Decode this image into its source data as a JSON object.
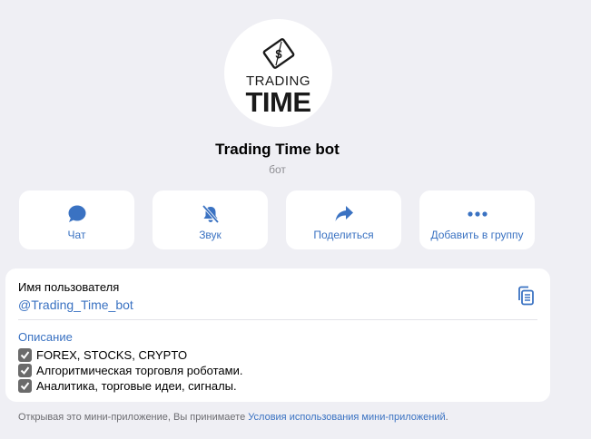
{
  "bot": {
    "logo_line1": "TRADING",
    "logo_line2": "TIME",
    "name": "Trading Time bot",
    "subtitle": "бот"
  },
  "actions": [
    {
      "label": "Чат",
      "icon": "chat-bubble-icon"
    },
    {
      "label": "Звук",
      "icon": "bell-slash-icon"
    },
    {
      "label": "Поделиться",
      "icon": "share-arrow-icon"
    },
    {
      "label": "Добавить в группу",
      "icon": "more-dots-icon"
    }
  ],
  "info": {
    "username_label": "Имя пользователя",
    "username_value": "@Trading_Time_bot",
    "copy_icon": "copy-icon",
    "description_label": "Описание",
    "description_lines": [
      "FOREX, STOCKS, CRYPTO",
      "Алгоритмическая торговля роботами.",
      "Аналитика, торговые идеи, сигналы."
    ]
  },
  "footer": {
    "text": "Открывая это мини-приложение, Вы принимаете ",
    "link": "Условия использования мини-приложений",
    "end": "."
  },
  "colors": {
    "accent": "#3a72c2",
    "background": "#efeff4",
    "card": "#ffffff",
    "muted": "#8e8e93"
  }
}
